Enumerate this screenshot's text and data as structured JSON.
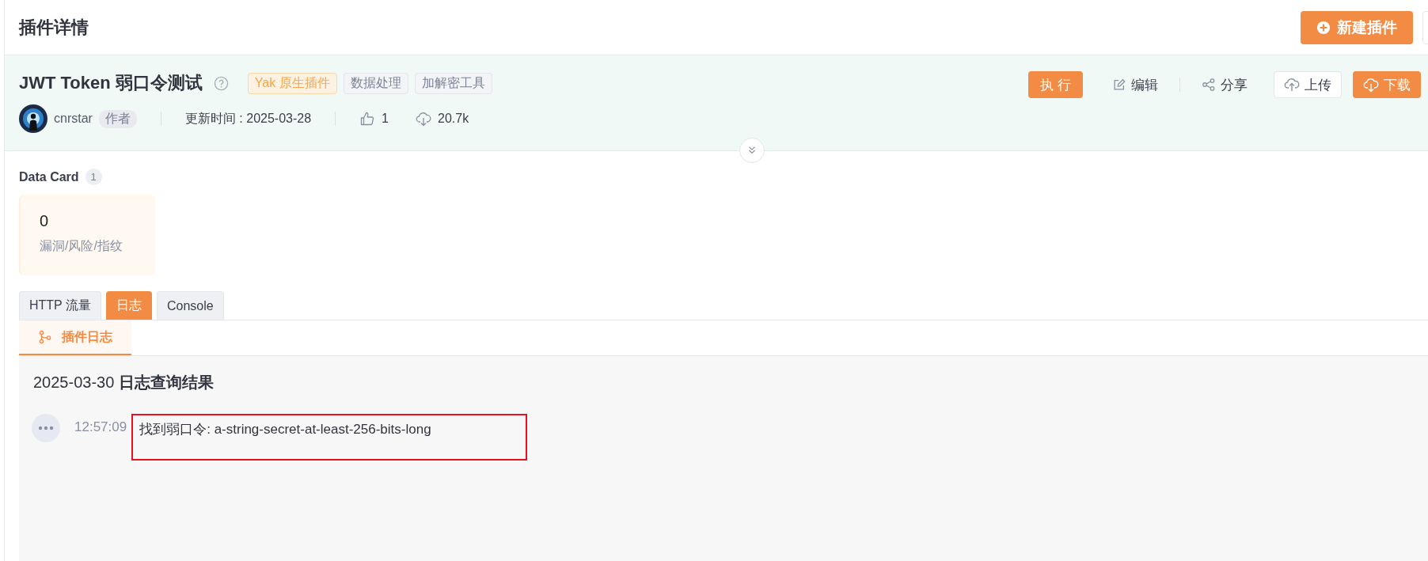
{
  "page": {
    "title": "插件详情",
    "new_button": "新建插件"
  },
  "plugin": {
    "name": "JWT Token 弱口令测试",
    "type_tag": "Yak 原生插件",
    "tags": [
      "数据处理",
      "加解密工具"
    ],
    "author": "cnrstar",
    "author_badge": "作者",
    "updated": "更新时间 : 2025-03-28",
    "likes": "1",
    "downloads": "20.7k",
    "actions": [
      {
        "kind": "execute",
        "label": "执 行"
      },
      {
        "kind": "edit",
        "label": "编辑"
      },
      {
        "kind": "share",
        "label": "分享"
      },
      {
        "kind": "upload",
        "label": "上传"
      },
      {
        "kind": "download",
        "label": "下载"
      }
    ]
  },
  "data_card": {
    "title": "Data Card",
    "count": "1",
    "cards": [
      {
        "value": "0",
        "label": "漏洞/风险/指纹"
      }
    ]
  },
  "tabs": [
    {
      "label": "HTTP 流量",
      "selected": false
    },
    {
      "label": "日志",
      "selected": true
    },
    {
      "label": "Console",
      "selected": false
    }
  ],
  "sub_tabs": [
    {
      "label": "插件日志",
      "selected": true
    }
  ],
  "log": {
    "heading": "2025-03-30 **日志查询结果**",
    "entries": [
      {
        "time": "12:57:09",
        "message": "找到弱口令: a-string-secret-at-least-256-bits-long",
        "highlighted": true
      }
    ]
  }
}
